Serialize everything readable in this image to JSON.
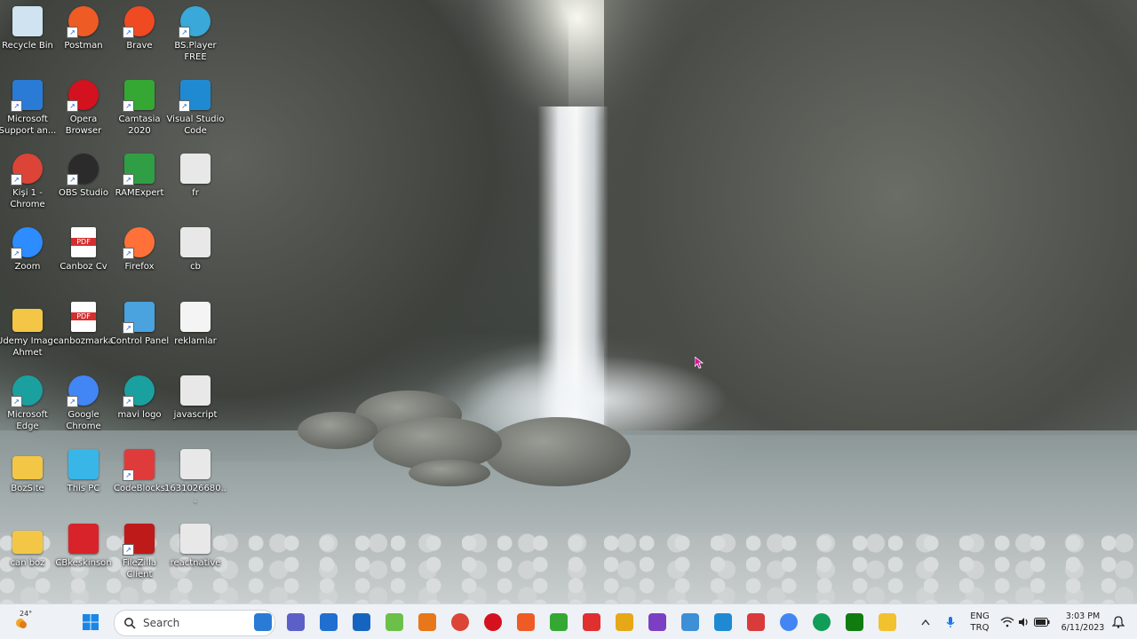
{
  "desktop": {
    "icons": [
      {
        "label": "Recycle Bin",
        "icon": "recycle-bin-icon",
        "shortcut": false
      },
      {
        "label": "Postman",
        "icon": "postman-icon",
        "shortcut": true
      },
      {
        "label": "Brave",
        "icon": "brave-icon",
        "shortcut": true
      },
      {
        "label": "BS.Player FREE",
        "icon": "bsplayer-icon",
        "shortcut": true
      },
      {
        "label": "Microsoft Support an...",
        "icon": "microsoft-support-icon",
        "shortcut": true
      },
      {
        "label": "Opera Browser",
        "icon": "opera-icon",
        "shortcut": true
      },
      {
        "label": "Camtasia 2020",
        "icon": "camtasia-icon",
        "shortcut": true
      },
      {
        "label": "Visual Studio Code",
        "icon": "vscode-icon",
        "shortcut": true
      },
      {
        "label": "Kişi 1 - Chrome",
        "icon": "chrome-profile-icon",
        "shortcut": true
      },
      {
        "label": "OBS Studio",
        "icon": "obs-icon",
        "shortcut": true
      },
      {
        "label": "RAMExpert",
        "icon": "ramexpert-icon",
        "shortcut": true
      },
      {
        "label": "fr",
        "icon": "image-file-icon",
        "shortcut": false
      },
      {
        "label": "Zoom",
        "icon": "zoom-icon",
        "shortcut": true
      },
      {
        "label": "Canboz Cv",
        "icon": "pdf-icon",
        "shortcut": false
      },
      {
        "label": "Firefox",
        "icon": "firefox-icon",
        "shortcut": true
      },
      {
        "label": "cb",
        "icon": "image-file-icon",
        "shortcut": false
      },
      {
        "label": "Udemy Image Ahmet",
        "icon": "folder-icon",
        "shortcut": false
      },
      {
        "label": "canbozmarka",
        "icon": "pdf-icon",
        "shortcut": false
      },
      {
        "label": "Control Panel",
        "icon": "control-panel-icon",
        "shortcut": true
      },
      {
        "label": "reklamlar",
        "icon": "text-file-icon",
        "shortcut": false
      },
      {
        "label": "Microsoft Edge",
        "icon": "edge-icon",
        "shortcut": true
      },
      {
        "label": "Google Chrome",
        "icon": "chrome-icon",
        "shortcut": true
      },
      {
        "label": "mavi logo",
        "icon": "edge-icon",
        "shortcut": true
      },
      {
        "label": "javascript",
        "icon": "image-file-icon",
        "shortcut": false
      },
      {
        "label": "BozSite",
        "icon": "folder-icon",
        "shortcut": false
      },
      {
        "label": "This PC",
        "icon": "this-pc-icon",
        "shortcut": false
      },
      {
        "label": "CodeBlocks",
        "icon": "codeblocks-icon",
        "shortcut": true
      },
      {
        "label": "1631026680...",
        "icon": "image-file-icon",
        "shortcut": false
      },
      {
        "label": "can boz",
        "icon": "user-folder-icon",
        "shortcut": false
      },
      {
        "label": "CBkeskinson",
        "icon": "cb-logo-icon",
        "shortcut": false
      },
      {
        "label": "FileZilla Client",
        "icon": "filezilla-icon",
        "shortcut": true
      },
      {
        "label": "reactnative",
        "icon": "image-file-icon",
        "shortcut": false
      }
    ]
  },
  "taskbar": {
    "weather": {
      "temp": "24°"
    },
    "search_label": "Search",
    "apps": [
      {
        "name": "copilot",
        "color": "#2a7bd6"
      },
      {
        "name": "teams",
        "color": "#5b5fc7"
      },
      {
        "name": "store",
        "color": "#1f6fd1"
      },
      {
        "name": "mail",
        "color": "#1565c0"
      },
      {
        "name": "notepad-plus",
        "color": "#6cc04a"
      },
      {
        "name": "sublime",
        "color": "#e8761a"
      },
      {
        "name": "chrome",
        "color": "#db4437"
      },
      {
        "name": "opera",
        "color": "#d4111e"
      },
      {
        "name": "postman",
        "color": "#ef5b25"
      },
      {
        "name": "camtasia",
        "color": "#35a833"
      },
      {
        "name": "camtasia-red",
        "color": "#e02f2f"
      },
      {
        "name": "snipping",
        "color": "#e6a817"
      },
      {
        "name": "visual-studio",
        "color": "#7b3fc4"
      },
      {
        "name": "paint",
        "color": "#3d8fd6"
      },
      {
        "name": "vscode",
        "color": "#1f8ad2"
      },
      {
        "name": "codeblocks",
        "color": "#d93a3a"
      },
      {
        "name": "chrome-2",
        "color": "#4285f4"
      },
      {
        "name": "chrome-3",
        "color": "#0f9d58"
      },
      {
        "name": "xbox",
        "color": "#107c10"
      },
      {
        "name": "file-explorer",
        "color": "#f2c12e"
      }
    ],
    "language": {
      "line1": "ENG",
      "line2": "TRQ"
    },
    "clock": {
      "time": "3:03 PM",
      "date": "6/11/2023"
    }
  }
}
